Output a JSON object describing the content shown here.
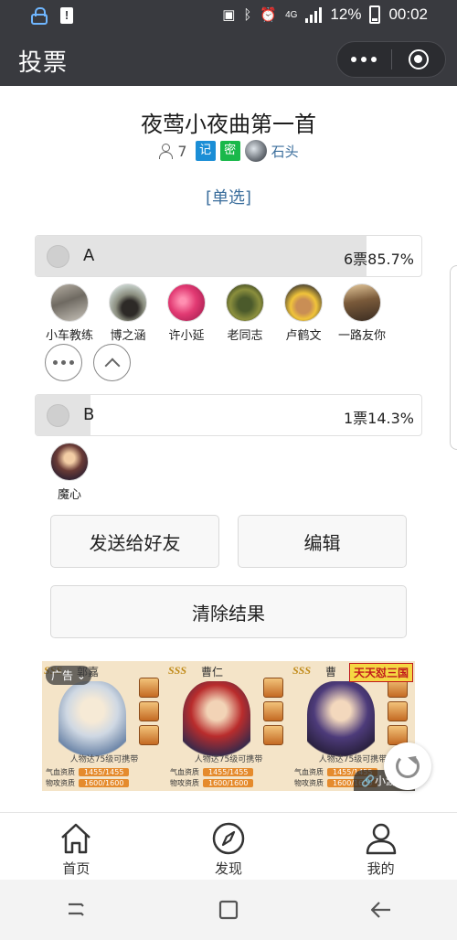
{
  "status_bar": {
    "network": "4G",
    "battery": "12%",
    "time": "00:02",
    "icons": [
      "lock-icon",
      "alert-icon",
      "screenshot-icon",
      "bluetooth-icon",
      "alarm-icon",
      "signal-icon",
      "battery-icon"
    ]
  },
  "nav": {
    "title": "投票",
    "more_icon": "more-dots-icon",
    "close_icon": "target-close-icon"
  },
  "vote": {
    "title": "夜莺小夜曲第一首",
    "participants": "7",
    "badge_record": "记",
    "badge_secret": "密",
    "author": "石头",
    "type": "[单选]"
  },
  "options": [
    {
      "letter": "A",
      "votes": "6票",
      "percent": "85.7%",
      "fill_fraction": 0.857,
      "voters": [
        "小车教练",
        "博之涵",
        "许小延",
        "老同志",
        "卢鹤文",
        "一路友你"
      ]
    },
    {
      "letter": "B",
      "votes": "1票",
      "percent": "14.3%",
      "fill_fraction": 0.143,
      "voters": [
        "魔心"
      ]
    }
  ],
  "buttons": {
    "send": "发送给好友",
    "edit": "编辑",
    "clear": "清除结果"
  },
  "ad": {
    "tag": "广告",
    "game": "天天怼三国",
    "mini_game": "小游戏",
    "heroes": [
      {
        "sss": "SSS",
        "name": "郭嘉"
      },
      {
        "sss": "SSS",
        "name": "曹仁"
      },
      {
        "sss": "SSS",
        "name": "曹"
      }
    ],
    "caption": "人物达75级可携带",
    "stat_hp_label": "气血资质",
    "stat_hp_value": "1455/1455",
    "stat_atk_label": "物攻资质",
    "stat_atk_value": "1600/1600"
  },
  "tabs": [
    {
      "label": "首页",
      "icon": "home-icon"
    },
    {
      "label": "发现",
      "icon": "compass-icon"
    },
    {
      "label": "我的",
      "icon": "user-icon"
    }
  ]
}
